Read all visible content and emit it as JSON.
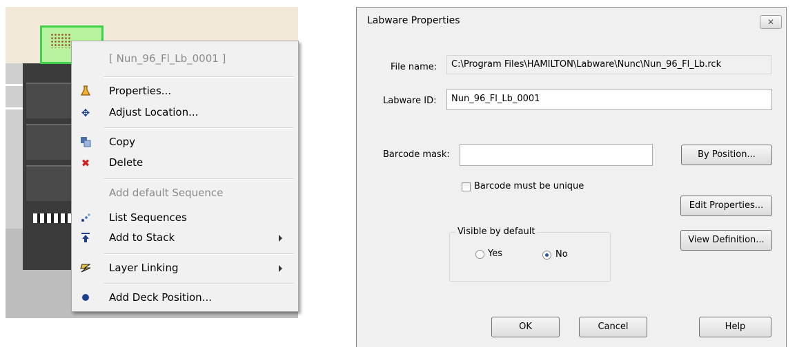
{
  "context_menu": {
    "header": "[ Nun_96_Fl_Lb_0001 ]",
    "items": [
      {
        "label": "Properties...",
        "icon": "flask-icon",
        "enabled": true
      },
      {
        "label": "Adjust Location...",
        "icon": "move-icon",
        "enabled": true
      },
      {
        "label": "Copy",
        "icon": "copy-icon",
        "enabled": true
      },
      {
        "label": "Delete",
        "icon": "delete-icon",
        "enabled": true,
        "icon_color": "#d42020"
      },
      {
        "label": "Add default Sequence",
        "icon": "",
        "enabled": false
      },
      {
        "label": "List Sequences",
        "icon": "sequence-icon",
        "enabled": true
      },
      {
        "label": "Add to Stack",
        "icon": "stack-icon",
        "enabled": true,
        "submenu": true
      },
      {
        "label": "Layer Linking",
        "icon": "layer-icon",
        "enabled": true,
        "submenu": true
      },
      {
        "label": "Add Deck Position...",
        "icon": "dot-icon",
        "enabled": true
      }
    ]
  },
  "dialog": {
    "title": "Labware Properties",
    "close_symbol": "✕",
    "file_name": {
      "label": "File name:",
      "value": "C:\\Program Files\\HAMILTON\\Labware\\Nunc\\Nun_96_Fl_Lb.rck"
    },
    "labware_id": {
      "label": "Labware ID:",
      "value": "Nun_96_Fl_Lb_0001"
    },
    "barcode_mask": {
      "label": "Barcode mask:",
      "value": ""
    },
    "barcode_unique": {
      "label": "Barcode must be unique",
      "checked": false
    },
    "visible_group": {
      "title": "Visible by default",
      "options": [
        {
          "label": "Yes",
          "selected": false
        },
        {
          "label": "No",
          "selected": true
        }
      ]
    },
    "buttons": {
      "by_position": "By Position...",
      "edit_properties": "Edit Properties...",
      "view_definition": "View Definition...",
      "ok": "OK",
      "cancel": "Cancel",
      "help": "Help"
    }
  },
  "colors": {
    "selection": "#3fd14a",
    "delete": "#d42020",
    "accent": "#2a5a9a"
  }
}
